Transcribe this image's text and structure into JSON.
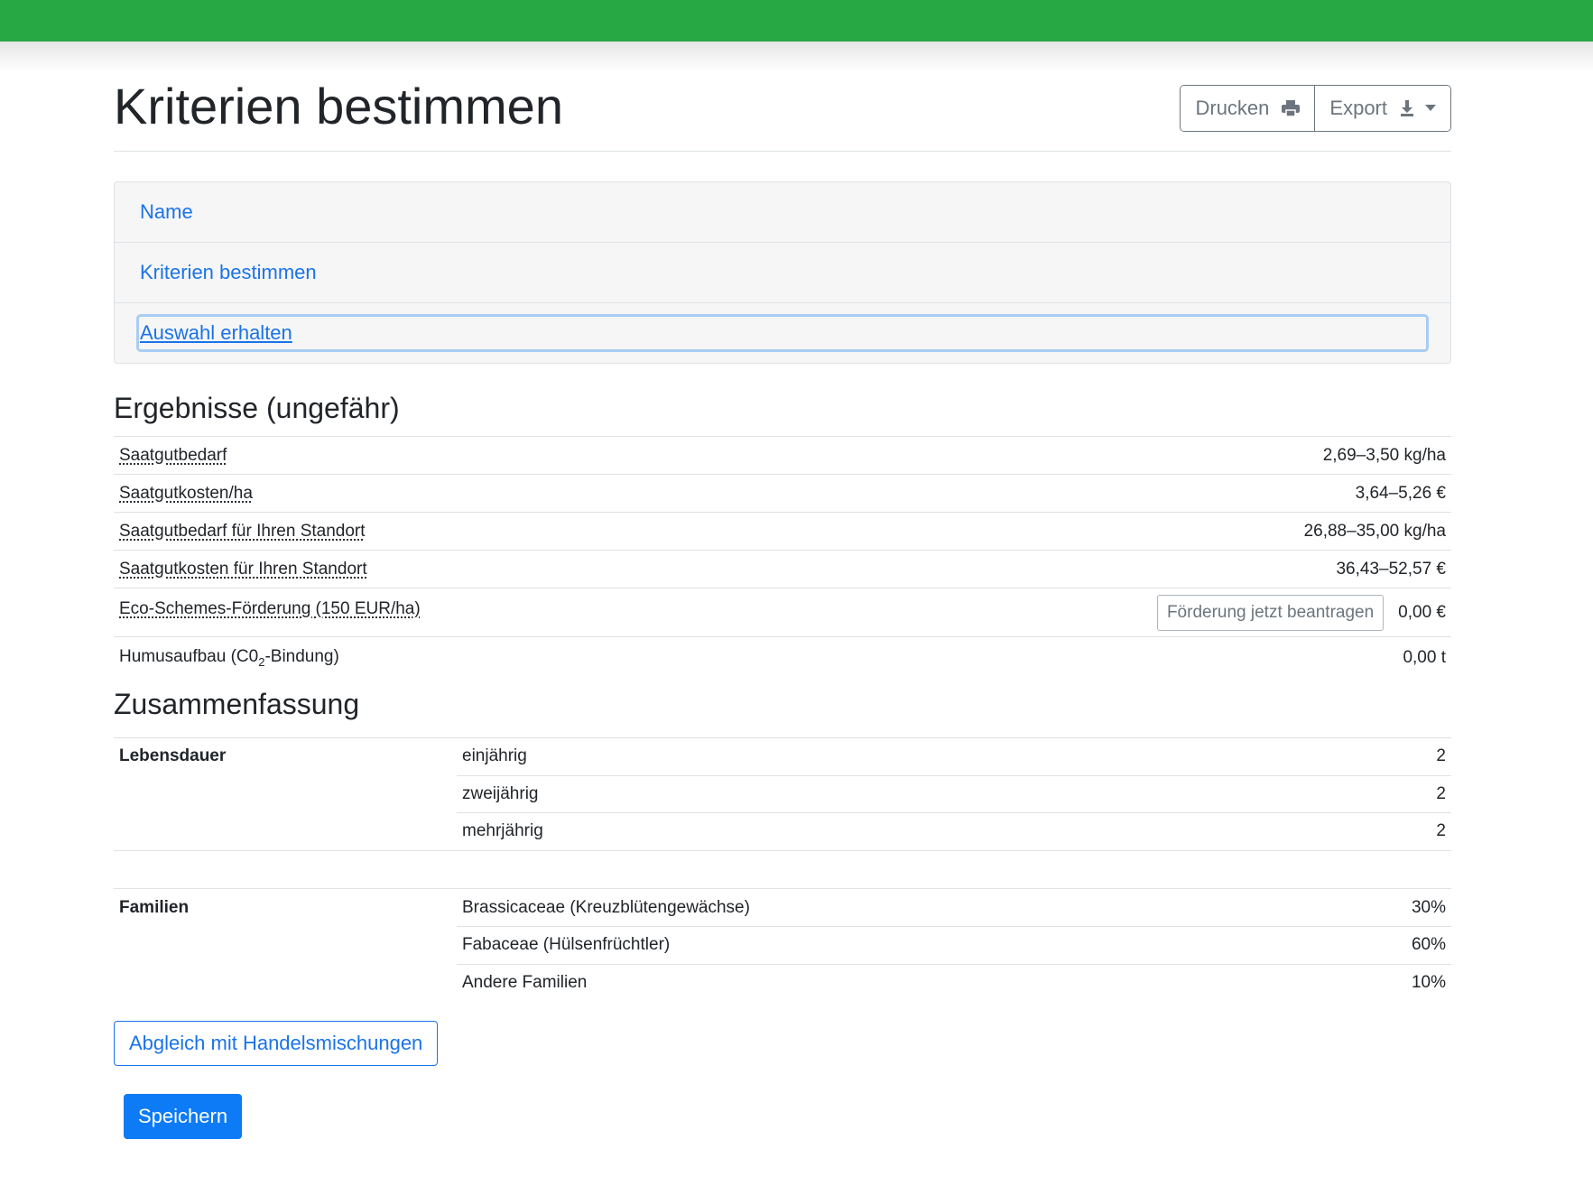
{
  "header": {
    "title": "Kriterien bestimmen",
    "print_label": "Drucken",
    "export_label": "Export",
    "print_icon": "printer-icon",
    "export_icon": "download-icon"
  },
  "nav": {
    "items": [
      {
        "label": "Name"
      },
      {
        "label": "Kriterien bestimmen"
      },
      {
        "label": "Auswahl erhalten"
      }
    ]
  },
  "results": {
    "heading": "Ergebnisse (ungefähr)",
    "rows": [
      {
        "label": "Saatgutbedarf",
        "value": "2,69–3,50 kg/ha"
      },
      {
        "label": "Saatgutkosten/ha",
        "value": "3,64–5,26 €"
      },
      {
        "label": "Saatgutbedarf für Ihren Standort",
        "value": "26,88–35,00 kg/ha"
      },
      {
        "label": "Saatgutkosten für Ihren Standort",
        "value": "36,43–52,57 €"
      },
      {
        "label": "Eco-Schemes-Förderung (150 EUR/ha)",
        "button": "Förderung jetzt beantragen",
        "value": "0,00 €"
      },
      {
        "label_prefix": "Humusaufbau (C0",
        "label_sub": "2",
        "label_suffix": "-Bindung)",
        "value": "0,00 t"
      }
    ]
  },
  "summary": {
    "heading": "Zusammenfassung",
    "lebensdauer": {
      "label": "Lebensdauer",
      "rows": [
        {
          "label": "einjährig",
          "value": "2"
        },
        {
          "label": "zweijährig",
          "value": "2"
        },
        {
          "label": "mehrjährig",
          "value": "2"
        }
      ]
    },
    "familien": {
      "label": "Familien",
      "rows": [
        {
          "label": "Brassicaceae (Kreuzblütengewächse)",
          "value": "30%"
        },
        {
          "label": "Fabaceae (Hülsenfrüchtler)",
          "value": "60%"
        },
        {
          "label": "Andere Familien",
          "value": "10%"
        }
      ]
    }
  },
  "actions": {
    "compare_label": "Abgleich mit Handelsmischungen",
    "save_label": "Speichern"
  },
  "colors": {
    "topbar": "#28a745",
    "link": "#1a73e8",
    "primary": "#0d7bf5"
  }
}
